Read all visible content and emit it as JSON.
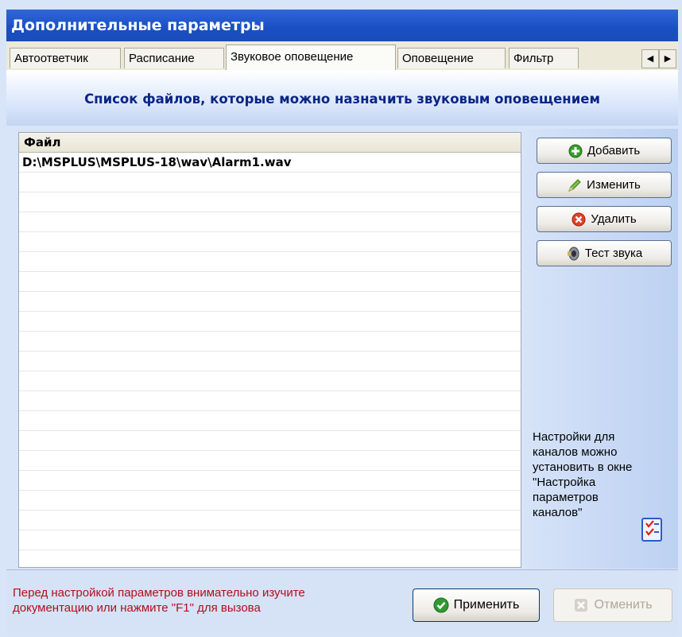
{
  "window": {
    "title": "Дополнительные параметры"
  },
  "tabs": [
    {
      "label": "Автоответчик",
      "active": false
    },
    {
      "label": "Расписание",
      "active": false
    },
    {
      "label": "Звуковое оповещение",
      "active": true
    },
    {
      "label": "Оповещение",
      "active": false
    },
    {
      "label": "Фильтр",
      "active": false
    }
  ],
  "tab_scroll": {
    "left_icon": "arrow-left-icon",
    "right_icon": "arrow-right-icon"
  },
  "header": {
    "text": "Список файлов, которые можно назначить звуковым оповещением"
  },
  "file_table": {
    "column_header": "Файл",
    "rows": [
      "D:\\MSPLUS\\MSPLUS-18\\wav\\Alarm1.wav"
    ]
  },
  "actions": {
    "add_label": "Добавить",
    "add_icon": "plus-circle-icon",
    "edit_label": "Изменить",
    "edit_icon": "pencil-icon",
    "delete_label": "Удалить",
    "delete_icon": "delete-circle-icon",
    "test_label": "Тест звука",
    "test_icon": "speaker-icon"
  },
  "note": {
    "lines": [
      "Настройки для",
      "каналов можно",
      "установить в окне",
      "\"Настройка",
      "параметров",
      "каналов\""
    ],
    "icon": "checklist-icon"
  },
  "footer": {
    "message_lines": [
      "Перед настройкой параметров внимательно изучите",
      "документацию или нажмите \"F1\" для вызова"
    ],
    "apply_label": "Применить",
    "apply_icon": "check-circle-icon",
    "cancel_label": "Отменить",
    "cancel_icon": "cancel-icon",
    "cancel_enabled": false
  },
  "colors": {
    "title_bar": "#1a4fc3",
    "header_text": "#0a2585",
    "footer_text": "#b0101a",
    "panel_bg": "#d6e3f8"
  }
}
